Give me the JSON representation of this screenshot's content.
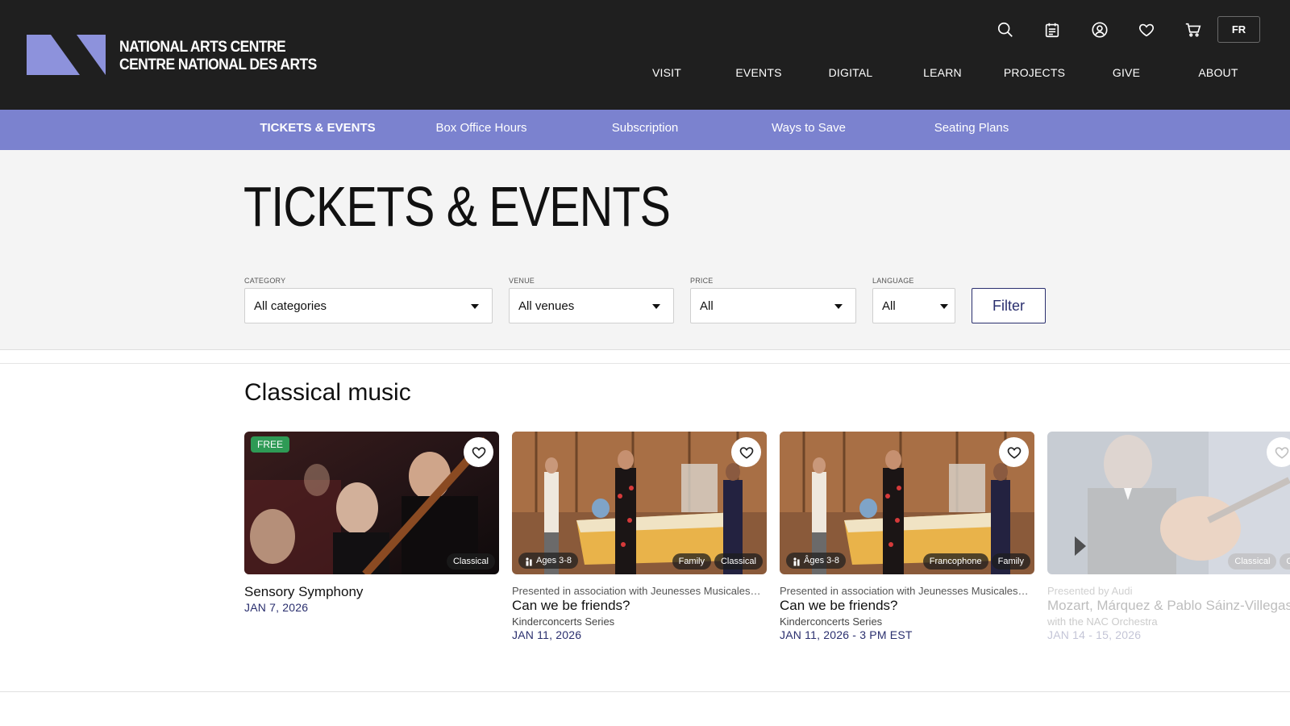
{
  "header": {
    "logo_text_line1": "NATIONAL ARTS CENTRE",
    "logo_text_line2": "CENTRE NATIONAL DES ARTS",
    "logo_color": "#8d92dc",
    "background": "#1f1f1f",
    "utility_icons": [
      "search-icon",
      "calendar-icon",
      "account-icon",
      "heart-icon",
      "cart-icon"
    ],
    "lang_button": "FR",
    "nav": [
      "VISIT",
      "EVENTS",
      "DIGITAL",
      "LEARN",
      "PROJECTS",
      "GIVE",
      "ABOUT"
    ]
  },
  "subnav": {
    "background": "#7b82cf",
    "items": [
      "TICKETS & EVENTS",
      "Box Office Hours",
      "Subscription",
      "Ways to Save",
      "Seating Plans"
    ],
    "active_index": 0
  },
  "page": {
    "title": "TICKETS & EVENTS"
  },
  "filters": {
    "category": {
      "label": "CATEGORY",
      "value": "All categories"
    },
    "venue": {
      "label": "VENUE",
      "value": "All venues"
    },
    "price": {
      "label": "PRICE",
      "value": "All"
    },
    "language": {
      "label": "LANGUAGE",
      "value": "All"
    },
    "submit": "Filter"
  },
  "section": {
    "title": "Classical music",
    "cards": [
      {
        "badge": "FREE",
        "tags": [
          "Classical"
        ],
        "title": "Sensory Symphony",
        "date": "JAN 7, 2026"
      },
      {
        "age": "Ages 3-8",
        "tags": [
          "Family",
          "Classical"
        ],
        "pre": "Presented in association with Jeunesses Musicales…",
        "title": "Can we be friends?",
        "series": "Kinderconcerts Series",
        "date": "JAN 11, 2026"
      },
      {
        "age": "Âges 3-8",
        "tags": [
          "Francophone",
          "Family"
        ],
        "pre": "Presented in association with Jeunesses Musicales…",
        "title": "Can we be friends?",
        "series": "Kinderconcerts Series",
        "date": "JAN 11, 2026 - 3 PM EST"
      },
      {
        "tags": [
          "Classical",
          "Creation"
        ],
        "pre": "Presented by Audi",
        "title": "Mozart, Márquez & Pablo Sáinz-Villegas",
        "series": "with the NAC Orchestra",
        "date": "JAN 14 - 15, 2026"
      }
    ]
  },
  "accent_colors": {
    "free_badge": "#2e9a55",
    "date_text": "#2a2f6e"
  }
}
